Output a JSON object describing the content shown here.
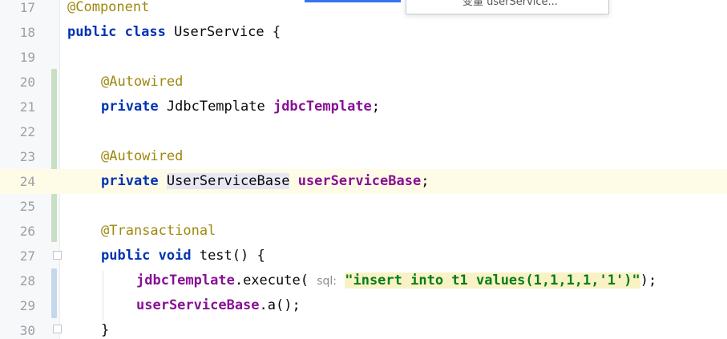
{
  "editor": {
    "lines": [
      {
        "num": "17",
        "text": "@Component"
      },
      {
        "num": "18",
        "kw": "public class",
        "rest": " UserService {"
      },
      {
        "num": "19"
      },
      {
        "num": "20",
        "ann": "@Autowired"
      },
      {
        "num": "21",
        "kw": "private",
        "type": " JdbcTemplate ",
        "field": "jdbcTemplate",
        "tail": ";"
      },
      {
        "num": "22"
      },
      {
        "num": "23",
        "ann": "@Autowired"
      },
      {
        "num": "24",
        "kw": "private",
        "sp": " ",
        "type": "UserServiceBase",
        "sp2": " ",
        "field": "userServiceBase",
        "tail": ";"
      },
      {
        "num": "25"
      },
      {
        "num": "26",
        "ann": "@Transactional"
      },
      {
        "num": "27",
        "kw": "public void",
        "rest": " test() {"
      },
      {
        "num": "28",
        "field": "jdbcTemplate",
        "call": ".execute( ",
        "hint": "sql:",
        "sp": " ",
        "str": "\"insert into t1 values(1,1,1,1,'1')\"",
        "tail": ");"
      },
      {
        "num": "29",
        "field": "userServiceBase",
        "tail": ".a();"
      },
      {
        "num": "30",
        "text": "}"
      }
    ],
    "popup_text": "变量 userService..."
  },
  "colors": {
    "keyword": "#0033b3",
    "annotation": "#9e880d",
    "field": "#871094",
    "string": "#067d17",
    "current_line": "#fefbe6"
  }
}
